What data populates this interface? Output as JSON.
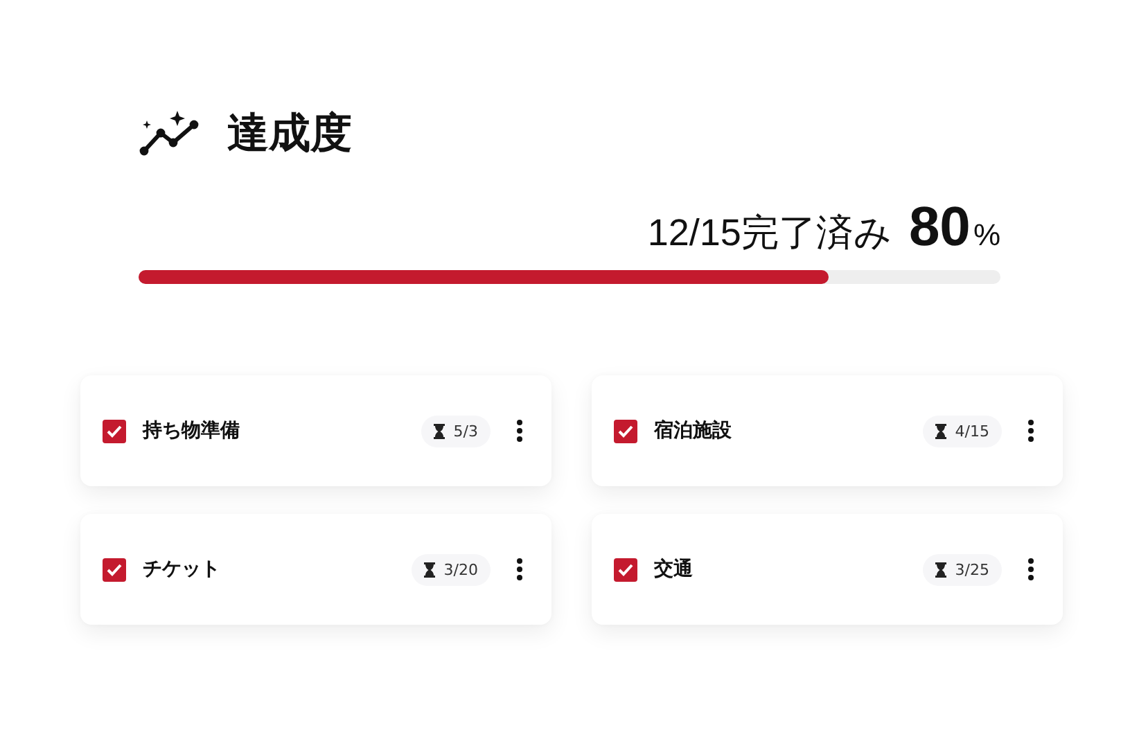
{
  "header": {
    "title": "達成度"
  },
  "progress": {
    "summary": "12/15完了済み",
    "percent": "80",
    "unit": "%",
    "level": 0.8
  },
  "tasks": [
    {
      "name": "持ち物準備",
      "checked": true,
      "count": "5/3"
    },
    {
      "name": "宿泊施設",
      "checked": true,
      "count": "4/15"
    },
    {
      "name": "チケット",
      "checked": true,
      "count": "3/20"
    },
    {
      "name": "交通",
      "checked": true,
      "count": "3/25"
    }
  ]
}
